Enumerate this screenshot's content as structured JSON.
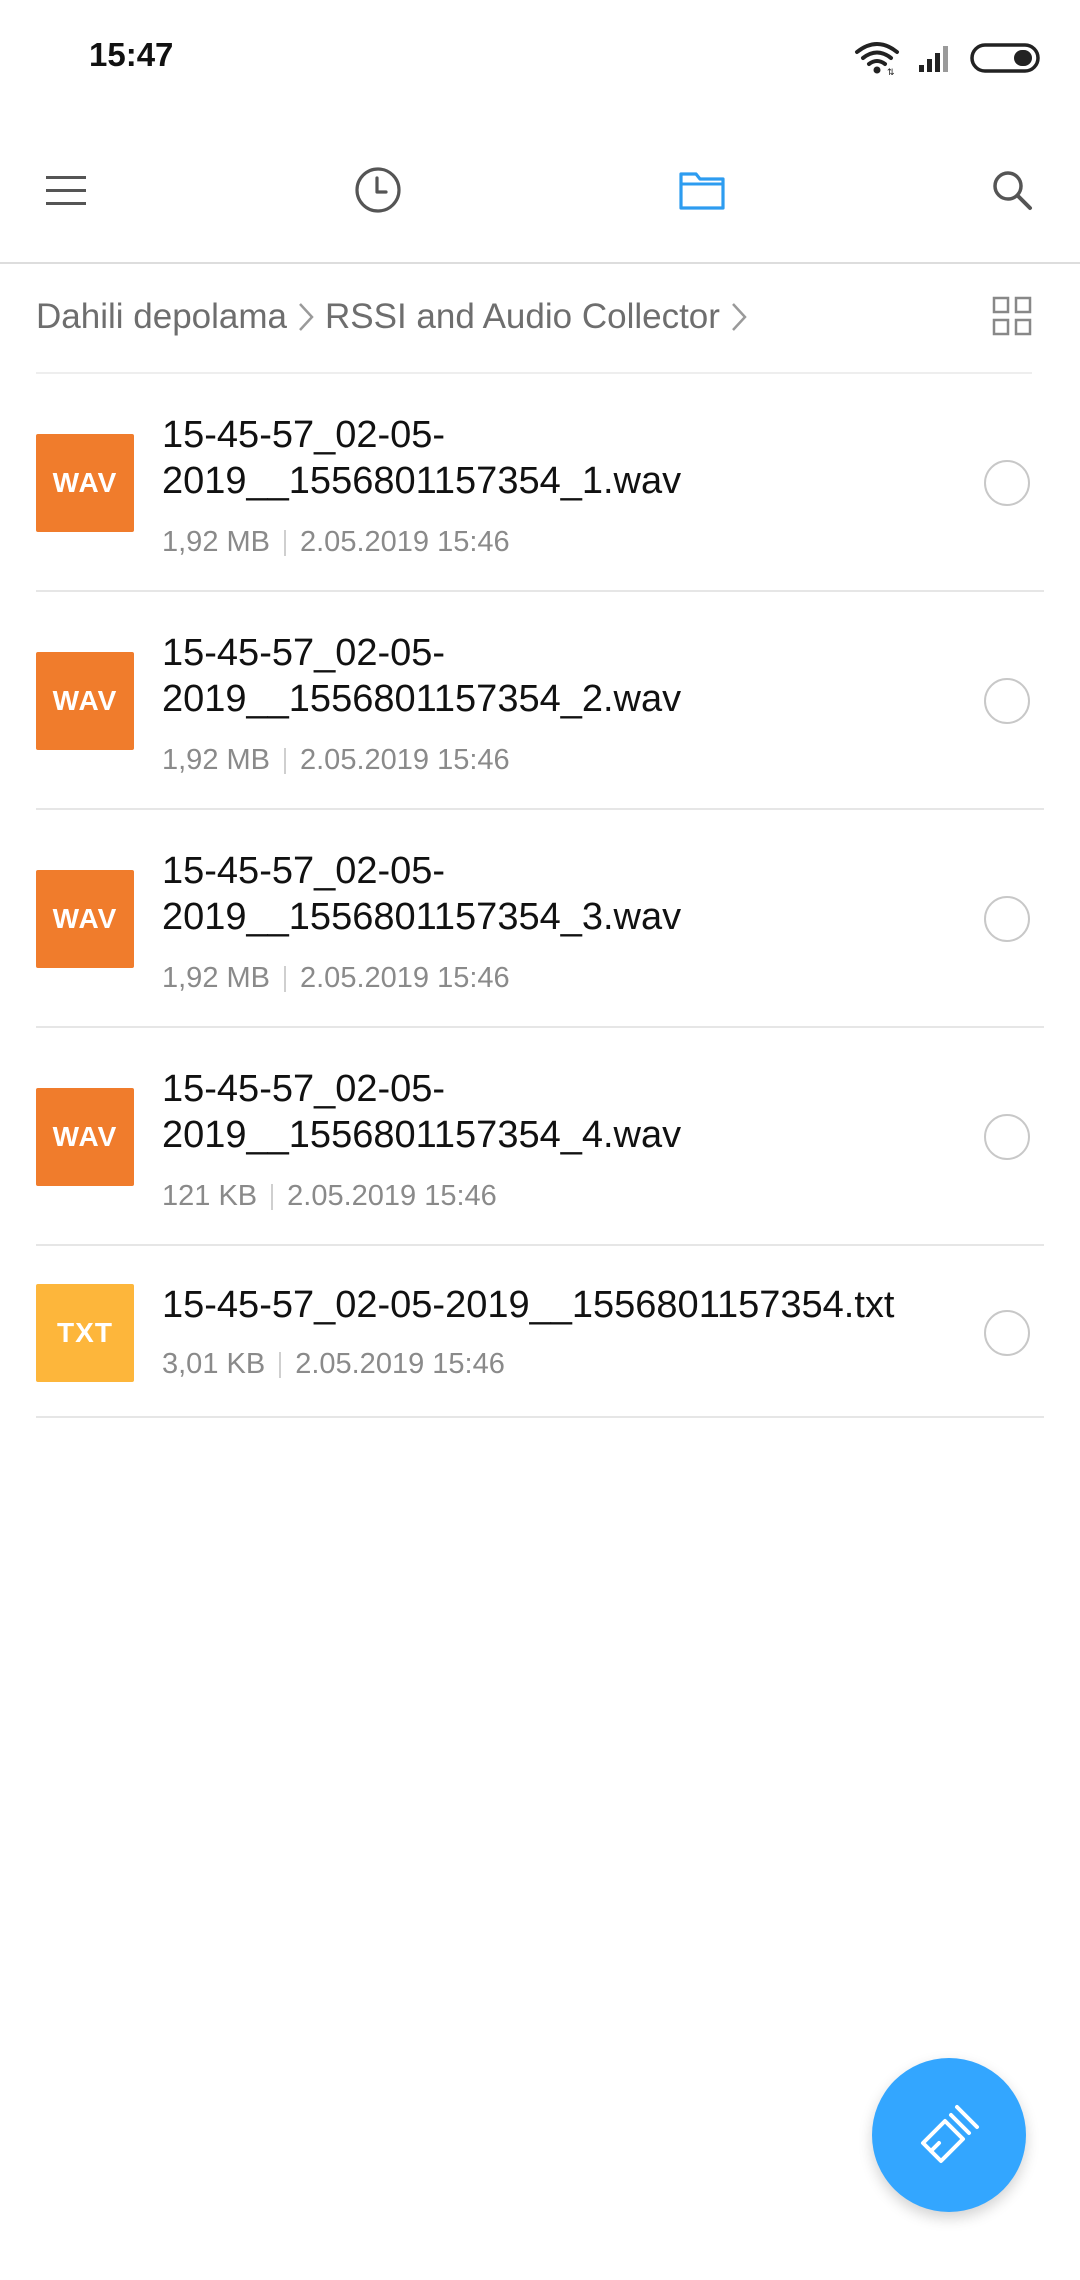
{
  "status_bar": {
    "time": "15:47",
    "icons": [
      "wifi-icon",
      "signal-icon",
      "battery-icon"
    ]
  },
  "toolbar": {
    "icons": [
      "menu-icon",
      "recent-clock-icon",
      "folder-icon",
      "search-icon"
    ],
    "active_tab": "folder-icon",
    "accent_color": "#2d9cf0"
  },
  "breadcrumb": {
    "items": [
      "Dahili depolama",
      "RSSI and Audio Collector"
    ]
  },
  "files": [
    {
      "type": "WAV",
      "name_line1": "15-45-57_02-05-",
      "name_line2": "2019__1556801157354_1.wav",
      "size": "1,92 MB",
      "date": "2.05.2019 15:46",
      "icon_color": "#f07c2c"
    },
    {
      "type": "WAV",
      "name_line1": "15-45-57_02-05-",
      "name_line2": "2019__1556801157354_2.wav",
      "size": "1,92 MB",
      "date": "2.05.2019 15:46",
      "icon_color": "#f07c2c"
    },
    {
      "type": "WAV",
      "name_line1": "15-45-57_02-05-",
      "name_line2": "2019__1556801157354_3.wav",
      "size": "1,92 MB",
      "date": "2.05.2019 15:46",
      "icon_color": "#f07c2c"
    },
    {
      "type": "WAV",
      "name_line1": "15-45-57_02-05-",
      "name_line2": "2019__1556801157354_4.wav",
      "size": "121 KB",
      "date": "2.05.2019 15:46",
      "icon_color": "#f07c2c"
    },
    {
      "type": "TXT",
      "name_line1": "15-45-57_02-05-2019__1556801157354.txt",
      "size": "3,01 KB",
      "date": "2.05.2019 15:46",
      "icon_color": "#fdb63b"
    }
  ],
  "fab": {
    "icon": "clean-brush-icon",
    "color": "#33a6ff"
  }
}
